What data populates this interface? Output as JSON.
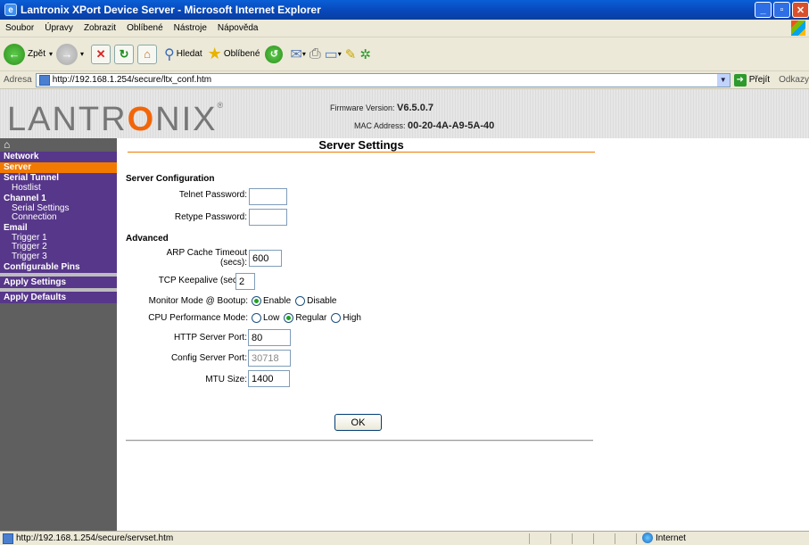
{
  "window": {
    "title": "Lantronix XPort Device Server - Microsoft Internet Explorer"
  },
  "menu": [
    "Soubor",
    "Úpravy",
    "Zobrazit",
    "Oblíbené",
    "Nástroje",
    "Nápověda"
  ],
  "toolbar": {
    "back": "Zpět",
    "search": "Hledat",
    "favorites": "Oblíbené"
  },
  "address": {
    "label": "Adresa",
    "url": "http://192.168.1.254/secure/ltx_conf.htm",
    "go": "Přejít",
    "links": "Odkazy"
  },
  "header": {
    "logo_left": "LANTR",
    "logo_x": "O",
    "logo_right": "NIX",
    "fw_label": "Firmware Version:",
    "fw_value": "V6.5.0.7",
    "mac_label": "MAC Address:",
    "mac_value": "00-20-4A-A9-5A-40"
  },
  "sidebar": {
    "network": "Network",
    "server": "Server",
    "serial_tunnel": "Serial Tunnel",
    "hostlist": "Hostlist",
    "channel1": "Channel 1",
    "serial_settings": "Serial Settings",
    "connection": "Connection",
    "email": "Email",
    "trigger1": "Trigger 1",
    "trigger2": "Trigger 2",
    "trigger3": "Trigger 3",
    "configurable_pins": "Configurable Pins",
    "apply_settings": "Apply Settings",
    "apply_defaults": "Apply Defaults"
  },
  "form": {
    "title": "Server Settings",
    "server_config": "Server Configuration",
    "telnet_password": "Telnet Password:",
    "retype_password": "Retype Password:",
    "advanced": "Advanced",
    "arp_label_1": "ARP Cache Timeout",
    "arp_label_2": "(secs):",
    "arp_value": "600",
    "tcp_label": "TCP Keepalive (secs):",
    "tcp_value": "2",
    "monitor_label": "Monitor Mode @ Bootup:",
    "monitor_enable": "Enable",
    "monitor_disable": "Disable",
    "cpu_label": "CPU Performance Mode:",
    "cpu_low": "Low",
    "cpu_regular": "Regular",
    "cpu_high": "High",
    "http_label": "HTTP Server Port:",
    "http_value": "80",
    "config_label": "Config Server Port:",
    "config_value": "30718",
    "mtu_label": "MTU Size:",
    "mtu_value": "1400",
    "ok": "OK"
  },
  "status": {
    "url": "http://192.168.1.254/secure/servset.htm",
    "zone": "Internet"
  }
}
